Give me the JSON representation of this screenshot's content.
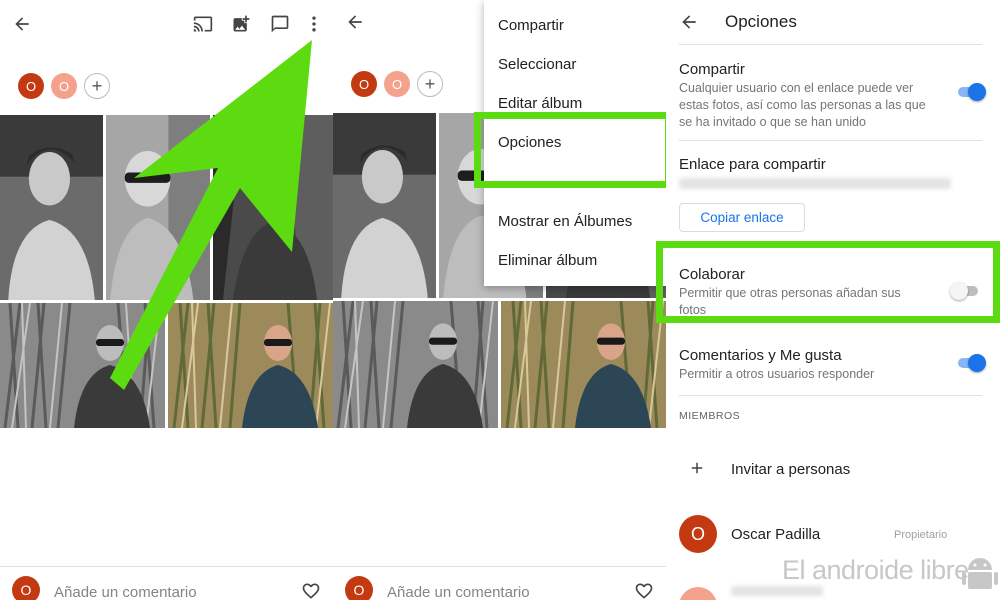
{
  "panel1": {
    "avatars": [
      "O",
      "O"
    ],
    "add_label": "+",
    "comment_avatar": "O",
    "comment_placeholder": "Añade un comentario"
  },
  "panel2": {
    "avatars": [
      "O",
      "O"
    ],
    "add_label": "+",
    "menu": [
      "Compartir",
      "Seleccionar",
      "Editar álbum",
      "Opciones",
      "Mostrar en Álbumes",
      "Eliminar álbum"
    ],
    "comment_avatar": "O",
    "comment_placeholder": "Añade un comentario"
  },
  "panel3": {
    "title": "Opciones",
    "share": {
      "title": "Compartir",
      "desc": "Cualquier usuario con el enlace puede ver estas fotos, así como las personas a las que se ha invitado o que se han unido",
      "enabled": true
    },
    "link": {
      "title": "Enlace para compartir",
      "copy_button": "Copiar enlace"
    },
    "collaborate": {
      "title": "Colaborar",
      "desc": "Permitir que otras personas añadan sus fotos",
      "enabled": false
    },
    "comments": {
      "title": "Comentarios y Me gusta",
      "desc": "Permitir a otros usuarios responder",
      "enabled": true
    },
    "members_header": "MIEMBROS",
    "invite_label": "Invitar a personas",
    "member": {
      "avatar": "O",
      "name": "Oscar Padilla",
      "role": "Propietario"
    }
  },
  "watermark": "El androide libre",
  "colors": {
    "highlight": "#5cdc10",
    "accent": "#1a73e8",
    "avatar_dark": "#c33a12",
    "avatar_light": "#f4a28c"
  },
  "icons": [
    "back-arrow-icon",
    "cast-icon",
    "add-photo-icon",
    "comment-icon",
    "more-vert-icon",
    "plus-icon",
    "heart-icon",
    "android-logo-icon"
  ]
}
